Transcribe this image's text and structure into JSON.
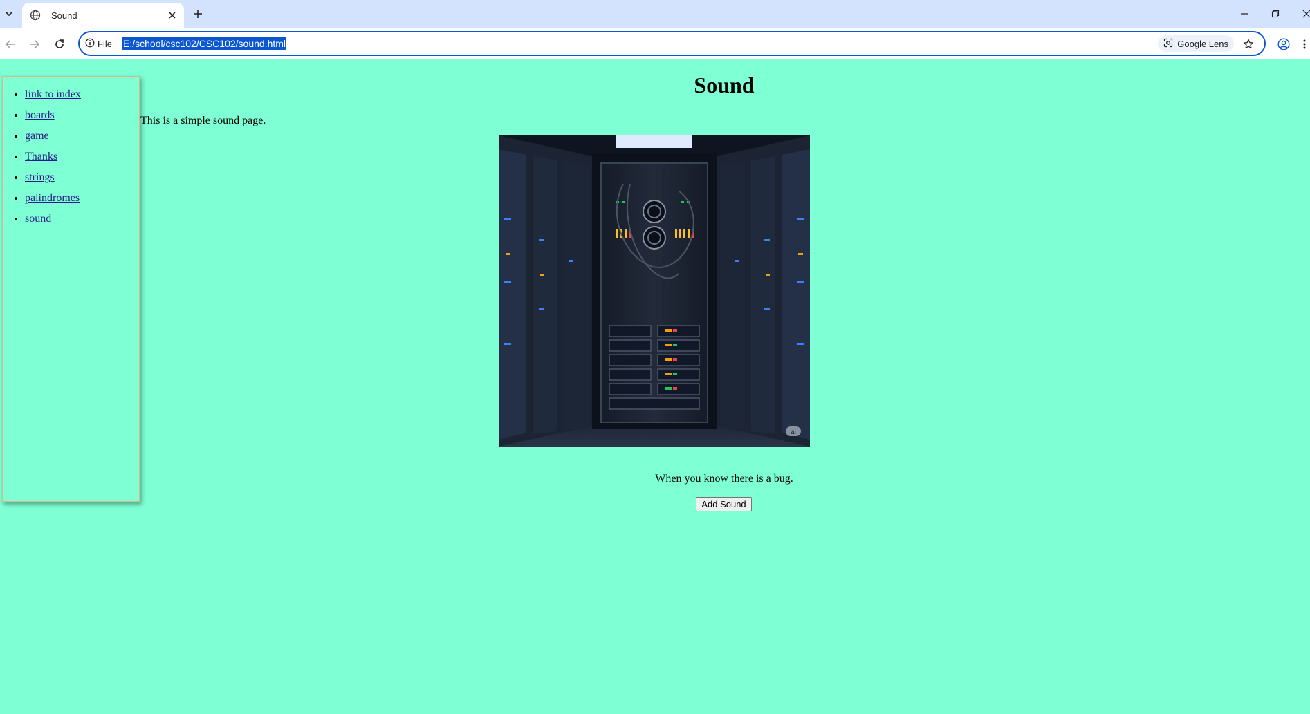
{
  "browser": {
    "tab_title": "Sound",
    "site_info_label": "File",
    "url": "E:/school/csc102/CSC102/sound.html",
    "lens_label": "Google Lens",
    "icons": {
      "tab_menu": "chevron-down-icon",
      "tab_favicon": "globe-icon",
      "tab_close": "close-icon",
      "new_tab": "plus-icon",
      "minimize": "minimize-icon",
      "restore": "restore-icon",
      "close_window": "close-icon",
      "back": "arrow-left-icon",
      "forward": "arrow-right-icon",
      "reload": "reload-icon",
      "site_info": "info-icon",
      "lens": "lens-icon",
      "bookmark": "star-icon",
      "profile": "profile-icon",
      "menu": "more-vertical-icon"
    }
  },
  "sidebar": {
    "links": [
      {
        "label": "link to index"
      },
      {
        "label": "boards"
      },
      {
        "label": "game"
      },
      {
        "label": "Thanks"
      },
      {
        "label": "strings"
      },
      {
        "label": "palindromes"
      },
      {
        "label": "sound"
      }
    ]
  },
  "main": {
    "heading": "Sound",
    "intro": "This is a simple sound page.",
    "image_badge": "ai",
    "caption": "When you know there is a bug.",
    "button_label": "Add Sound"
  },
  "colors": {
    "page_background": "#7fffd4",
    "sidebar_border": "#d7b98e",
    "accent": "#0b57d0"
  }
}
